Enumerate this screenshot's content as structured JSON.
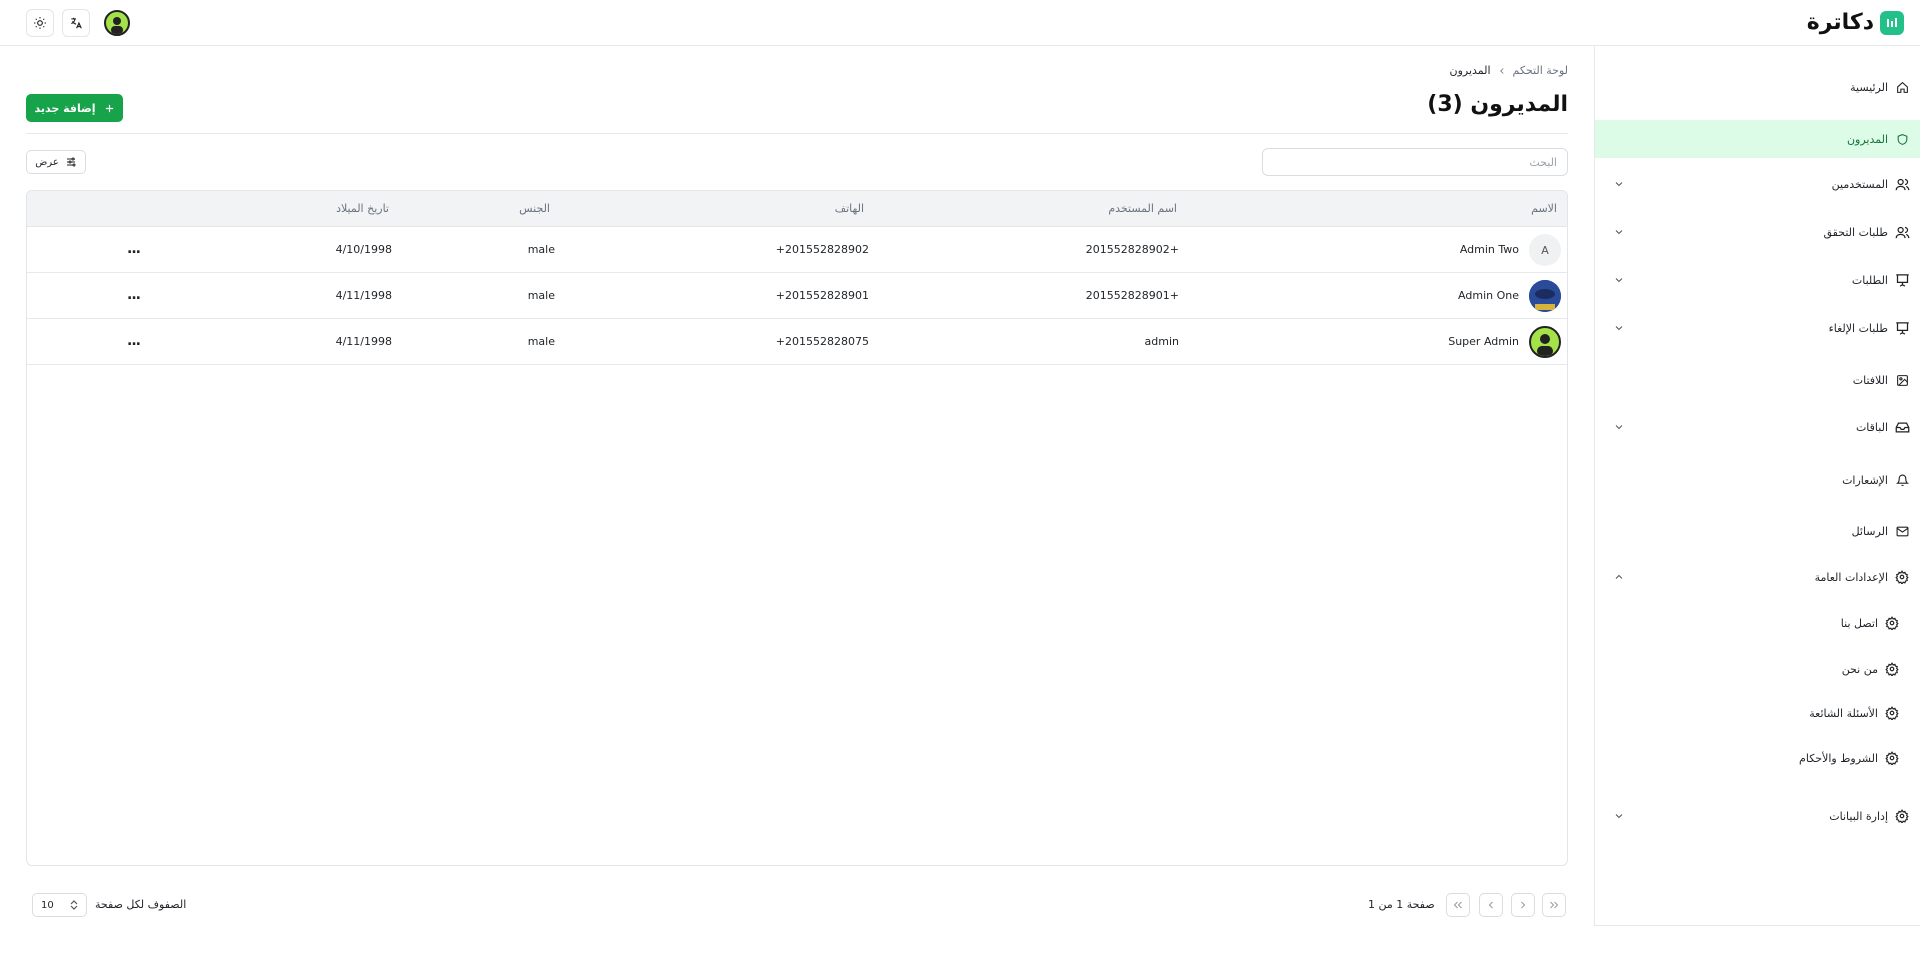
{
  "app": {
    "brand": "دكاترة"
  },
  "colors": {
    "accent": "#16a34a",
    "active_bg": "#dcfce7",
    "logo": "#24c08a"
  },
  "topbar": {
    "icons": [
      "theme-toggle-icon",
      "translate-icon",
      "user-avatar"
    ]
  },
  "sidebar": {
    "items": [
      {
        "label": "الرئيسية",
        "icon": "home-icon",
        "expandable": false,
        "active": false
      },
      {
        "label": "المديرون",
        "icon": "shield-icon",
        "expandable": false,
        "active": true
      },
      {
        "label": "المستخدمين",
        "icon": "users-icon",
        "expandable": true,
        "active": false
      },
      {
        "label": "طلبات التحقق",
        "icon": "users-icon",
        "expandable": true,
        "active": false
      },
      {
        "label": "الطلبات",
        "icon": "presentation-icon",
        "expandable": true,
        "active": false
      },
      {
        "label": "طلبات الإلغاء",
        "icon": "presentation-icon",
        "expandable": true,
        "active": false
      },
      {
        "label": "اللافتات",
        "icon": "image-icon",
        "expandable": false,
        "active": false
      },
      {
        "label": "الباقات",
        "icon": "inbox-icon",
        "expandable": true,
        "active": false
      },
      {
        "label": "الإشعارات",
        "icon": "bell-icon",
        "expandable": false,
        "active": false
      },
      {
        "label": "الرسائل",
        "icon": "mail-icon",
        "expandable": false,
        "active": false
      },
      {
        "label": "الإعدادات العامة",
        "icon": "gear-icon",
        "expandable": true,
        "expanded": true,
        "active": false
      },
      {
        "label": "اتصل بنا",
        "icon": "gear-icon",
        "sub": true
      },
      {
        "label": "من نحن",
        "icon": "gear-icon",
        "sub": true
      },
      {
        "label": "الأسئلة الشائعة",
        "icon": "gear-icon",
        "sub": true
      },
      {
        "label": "الشروط والأحكام",
        "icon": "gear-icon",
        "sub": true
      },
      {
        "label": "إدارة البيانات",
        "icon": "gear-icon",
        "expandable": true,
        "active": false
      }
    ]
  },
  "breadcrumb": {
    "root": "لوحة التحكم",
    "current": "المديرون"
  },
  "page": {
    "title": "المديرون (3)",
    "add_label": "إضافة جديد"
  },
  "toolbar": {
    "search_placeholder": "البحث",
    "view_label": "عرض"
  },
  "table": {
    "columns": [
      "الاسم",
      "اسم المستخدم",
      "الهاتف",
      "الجنس",
      "تاريخ الميلاد"
    ],
    "rows": [
      {
        "avatar": "A",
        "name": "Admin Two",
        "username": "201552828902+",
        "phone": "+201552828902",
        "gender": "male",
        "birthdate": "4/10/1998",
        "actions": "..."
      },
      {
        "avatar": "",
        "name": "Admin One",
        "username": "201552828901+",
        "phone": "+201552828901",
        "gender": "male",
        "birthdate": "4/11/1998",
        "actions": "..."
      },
      {
        "avatar": "",
        "name": "Super Admin",
        "username": "admin",
        "phone": "+201552828075",
        "gender": "male",
        "birthdate": "4/11/1998",
        "actions": "..."
      }
    ]
  },
  "footer": {
    "rows_per_page_label": "الصفوف لكل صفحة",
    "rows_per_page_value": "10",
    "page_status": "صفحة 1 من 1"
  }
}
